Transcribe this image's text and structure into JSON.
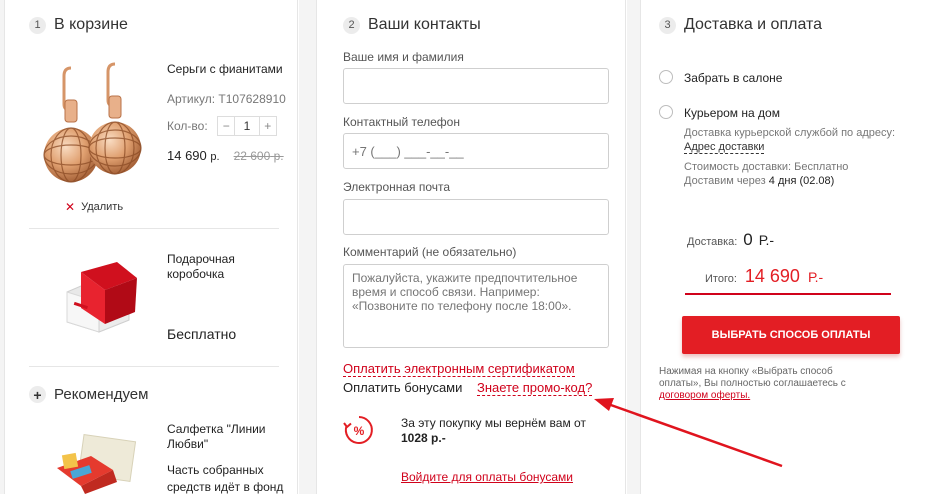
{
  "cart": {
    "num": "1",
    "title": "В корзине",
    "product": {
      "name": "Серьги с фианитами",
      "article": "Артикул: Т107628910",
      "qty_label": "Кол-во:",
      "qty_minus": "−",
      "qty_value": "1",
      "qty_plus": "+",
      "price": "14 690",
      "price_cur": "р.",
      "old_price": "22 600",
      "old_cur": "р.",
      "delete": "Удалить"
    },
    "gift": {
      "name_line1": "Подарочная",
      "name_line2": "коробочка",
      "price": "Бесплатно"
    },
    "recommend": {
      "title": "Рекомендуем",
      "item_line1": "Салфетка \"Линии",
      "item_line2": "Любви\"",
      "desc_line1": "Часть собранных",
      "desc_line2": "средств идёт в фонд"
    }
  },
  "contacts": {
    "num": "2",
    "title": "Ваши контакты",
    "name_label": "Ваше имя и фамилия",
    "phone_label": "Контактный телефон",
    "phone_placeholder": "+7 (___) ___-__-__",
    "email_label": "Электронная почта",
    "comment_label": "Комментарий (не обязательно)",
    "comment_placeholder": "Пожалуйста, укажите предпочтительное время и способ связи. Например: «Позвоните по телефону после 18:00».",
    "cert_link": "Оплатить электронным сертификатом",
    "bonus_text": "Оплатить бонусами",
    "promo_link": "Знаете промо-код?",
    "cashback_text": "За эту покупку мы вернём вам от",
    "cashback_amount": "1028 р.-",
    "login_link": "Войдите для оплаты бонусами"
  },
  "delivery": {
    "num": "3",
    "title": "Доставка и оплата",
    "opt1": "Забрать в салоне",
    "opt2": "Курьером на дом",
    "courier_desc": "Доставка курьерской службой по адресу:",
    "address_link": "Адрес доставки",
    "cost_text": "Стоимость доставки: Бесплатно",
    "eta_prefix": "Доставим через",
    "eta_days": "4 дня",
    "eta_date": "(02.08)",
    "delivery_label": "Доставка:",
    "delivery_value": "0",
    "delivery_cur": "Р.-",
    "total_label": "Итого:",
    "total_value": "14 690",
    "total_cur": "Р.-",
    "pay_button": "ВЫБРАТЬ СПОСОБ ОПЛАТЫ",
    "agree_line1": "Нажимая на кнопку «Выбрать способ",
    "agree_line2": "оплаты», Вы полностью соглашаетесь с",
    "offer_link": "договором оферты."
  },
  "colors": {
    "accent": "#e31e24",
    "link_red": "#d0021b",
    "annotation_arrow": "#e0141e"
  }
}
